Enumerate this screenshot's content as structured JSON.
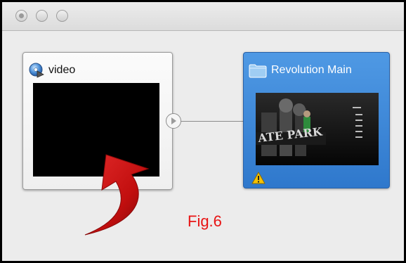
{
  "window": {
    "controls": [
      "close",
      "minimize",
      "zoom"
    ]
  },
  "nodes": {
    "video": {
      "title": "video",
      "icon": "video-disc-icon"
    },
    "menu": {
      "title": "Revolution Main",
      "icon": "folder-icon",
      "warning_icon": "warning-icon",
      "thumbnail_text": "ATE PARK"
    }
  },
  "annotation": {
    "label": "Fig.6"
  },
  "colors": {
    "selected_node": "#3a86d8",
    "annotation_red": "#e81414",
    "arrow_red": "#c80f0f"
  }
}
